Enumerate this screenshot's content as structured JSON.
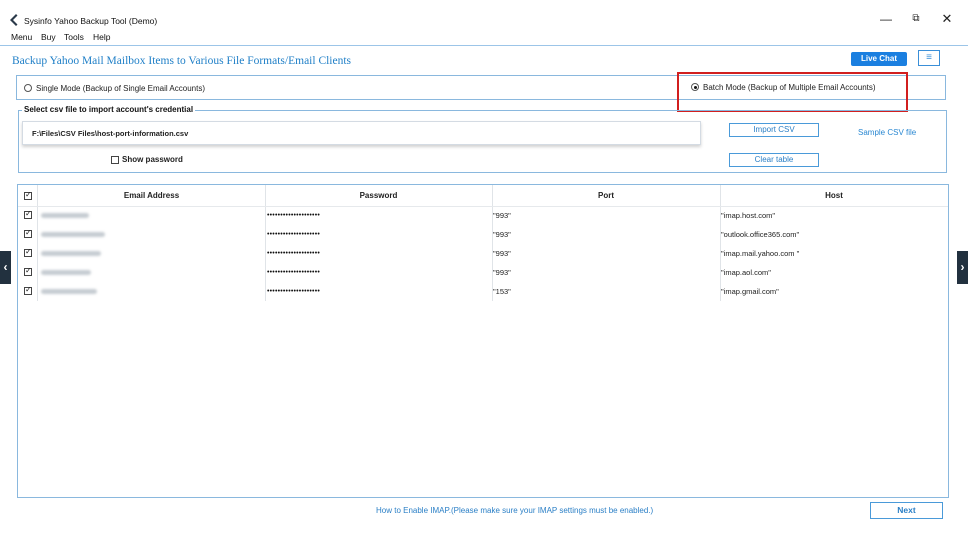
{
  "window": {
    "title": "Sysinfo Yahoo Backup Tool (Demo)",
    "controls": {
      "minimize": "—",
      "maximize": "⧉",
      "close": "✕"
    }
  },
  "menu": [
    "Menu",
    "Buy",
    "Tools",
    "Help"
  ],
  "header": {
    "title": "Backup Yahoo Mail Mailbox Items to Various File Formats/Email Clients",
    "live_chat": "Live Chat",
    "menu_icon": "≡"
  },
  "modes": {
    "single": {
      "label": "Single Mode (Backup of Single Email Accounts)",
      "selected": false
    },
    "batch": {
      "label": "Batch Mode (Backup of Multiple Email Accounts)",
      "selected": true
    }
  },
  "csv": {
    "legend": "Select csv file to import account's credential",
    "path": "F:\\Files\\CSV Files\\host-port-information.csv",
    "show_password": "Show password",
    "import_button": "Import CSV",
    "clear_button": "Clear table",
    "sample_link": "Sample CSV file"
  },
  "table": {
    "columns": [
      "Email Address",
      "Password",
      "Port",
      "Host"
    ],
    "rows": [
      {
        "checked": true,
        "password": "••••••••••••••••••••",
        "port": "\"993\"",
        "host": "\"imap.host.com\""
      },
      {
        "checked": true,
        "password": "••••••••••••••••••••",
        "port": "\"993\"",
        "host": "\"outlook.office365.com\""
      },
      {
        "checked": true,
        "password": "••••••••••••••••••••",
        "port": "\"993\"",
        "host": "\"imap.mail.yahoo.com \""
      },
      {
        "checked": true,
        "password": "••••••••••••••••••••",
        "port": "\"993\"",
        "host": "\"imap.aol.com\""
      },
      {
        "checked": true,
        "password": "••••••••••••••••••••",
        "port": "\"153\"",
        "host": "\"imap.gmail.com\""
      }
    ]
  },
  "footer": {
    "imap_link": "How to Enable IMAP.(Please make sure your IMAP settings must be enabled.)",
    "next_button": "Next"
  },
  "nav": {
    "prev": "‹",
    "next": "›"
  },
  "colors": {
    "accent": "#1f7fc7",
    "live_chat_bg": "#1b7fe0",
    "highlight": "#d11f1f",
    "border": "#8ab8de"
  }
}
